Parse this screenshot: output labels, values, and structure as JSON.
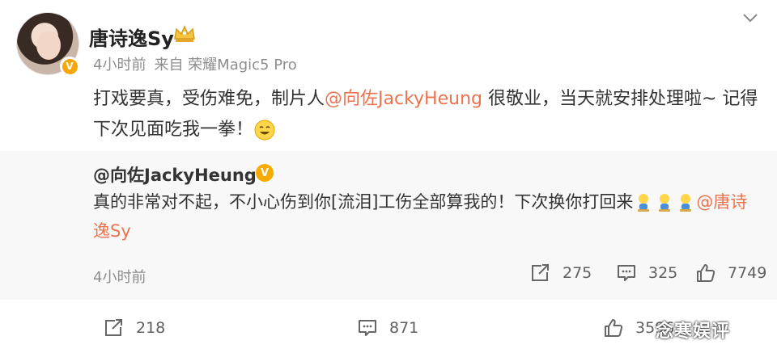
{
  "post": {
    "user_name": "唐诗逸Sy",
    "time": "4小时前",
    "source": "来自 荣耀Magic5 Pro",
    "content_before": "打戏要真，受伤难免，制片人",
    "mention": "@向佐JackyHeung",
    "content_after": " 很敬业，当天就安排处理啦~ 记得下次见面吃我一拳！"
  },
  "retweet": {
    "user_name": "@向佐JackyHeung",
    "text": "真的非常对不起，不小心伤到你[流泪]工伤全部算我的！下次换你打回来",
    "mention": "@唐诗逸Sy",
    "time": "4小时前",
    "stats": {
      "reposts": "275",
      "comments": "325",
      "likes": "7749"
    }
  },
  "footer": {
    "reposts": "218",
    "comments": "871",
    "likes": "3596"
  },
  "watermark": "念寒娱评",
  "icons": {
    "more": "chevron-down-icon",
    "repost": "repost-icon",
    "comment": "comment-icon",
    "like": "like-icon"
  },
  "colors": {
    "mention": "#eb7350",
    "verified": "#f6a609",
    "retweet_bg": "#f8f8f8"
  }
}
